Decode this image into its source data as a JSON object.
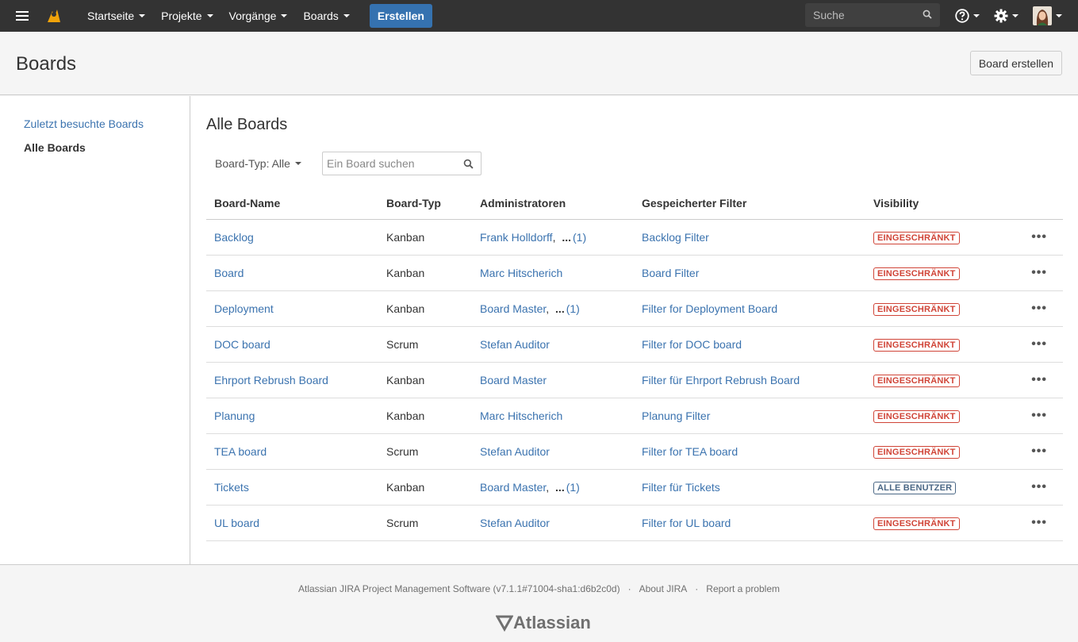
{
  "header": {
    "nav": [
      "Startseite",
      "Projekte",
      "Vorgänge",
      "Boards"
    ],
    "create_label": "Erstellen",
    "search_placeholder": "Suche"
  },
  "page": {
    "title": "Boards",
    "create_board_label": "Board erstellen"
  },
  "sidebar": {
    "items": [
      {
        "label": "Zuletzt besuchte Boards",
        "active": false
      },
      {
        "label": "Alle Boards",
        "active": true
      }
    ]
  },
  "main": {
    "title": "Alle Boards",
    "filter_label": "Board-Typ: Alle",
    "search_placeholder": "Ein Board suchen"
  },
  "table": {
    "columns": [
      "Board-Name",
      "Board-Typ",
      "Administratoren",
      "Gespeicherter Filter",
      "Visibility"
    ],
    "rows": [
      {
        "name": "Backlog",
        "type": "Kanban",
        "admin": "Frank Holldorff",
        "more": "(1)",
        "filter": "Backlog Filter",
        "visibility": "EINGESCHRÄNKT"
      },
      {
        "name": "Board",
        "type": "Kanban",
        "admin": "Marc Hitscherich",
        "more": "",
        "filter": "Board Filter",
        "visibility": "EINGESCHRÄNKT"
      },
      {
        "name": "Deployment",
        "type": "Kanban",
        "admin": "Board Master",
        "more": "(1)",
        "filter": "Filter for Deployment Board",
        "visibility": "EINGESCHRÄNKT"
      },
      {
        "name": "DOC board",
        "type": "Scrum",
        "admin": "Stefan Auditor",
        "more": "",
        "filter": "Filter for DOC board",
        "visibility": "EINGESCHRÄNKT"
      },
      {
        "name": "Ehrport Rebrush Board",
        "type": "Kanban",
        "admin": "Board Master",
        "more": "",
        "filter": "Filter für Ehrport Rebrush Board",
        "visibility": "EINGESCHRÄNKT"
      },
      {
        "name": "Planung",
        "type": "Kanban",
        "admin": "Marc Hitscherich",
        "more": "",
        "filter": "Planung Filter",
        "visibility": "EINGESCHRÄNKT"
      },
      {
        "name": "TEA board",
        "type": "Scrum",
        "admin": "Stefan Auditor",
        "more": "",
        "filter": "Filter for TEA board",
        "visibility": "EINGESCHRÄNKT"
      },
      {
        "name": "Tickets",
        "type": "Kanban",
        "admin": "Board Master",
        "more": "(1)",
        "filter": "Filter für Tickets",
        "visibility": "ALLE BENUTZER"
      },
      {
        "name": "UL board",
        "type": "Scrum",
        "admin": "Stefan Auditor",
        "more": "",
        "filter": "Filter for UL board",
        "visibility": "EINGESCHRÄNKT"
      }
    ]
  },
  "footer": {
    "version": "Atlassian JIRA Project Management Software (v7.1.1#71004-sha1:d6b2c0d)",
    "about": "About JIRA",
    "report": "Report a problem",
    "logo_text": "Atlassian"
  },
  "colors": {
    "link": "#3b73af",
    "header_bg": "#333333",
    "create_button": "#3572b0",
    "restricted": "#d04437",
    "all_users": "#4a6785"
  },
  "icons": [
    "menu-icon",
    "jira-logo-icon",
    "search-icon",
    "help-icon",
    "gear-icon",
    "avatar",
    "more-actions-icon",
    "atlassian-logo-icon"
  ]
}
